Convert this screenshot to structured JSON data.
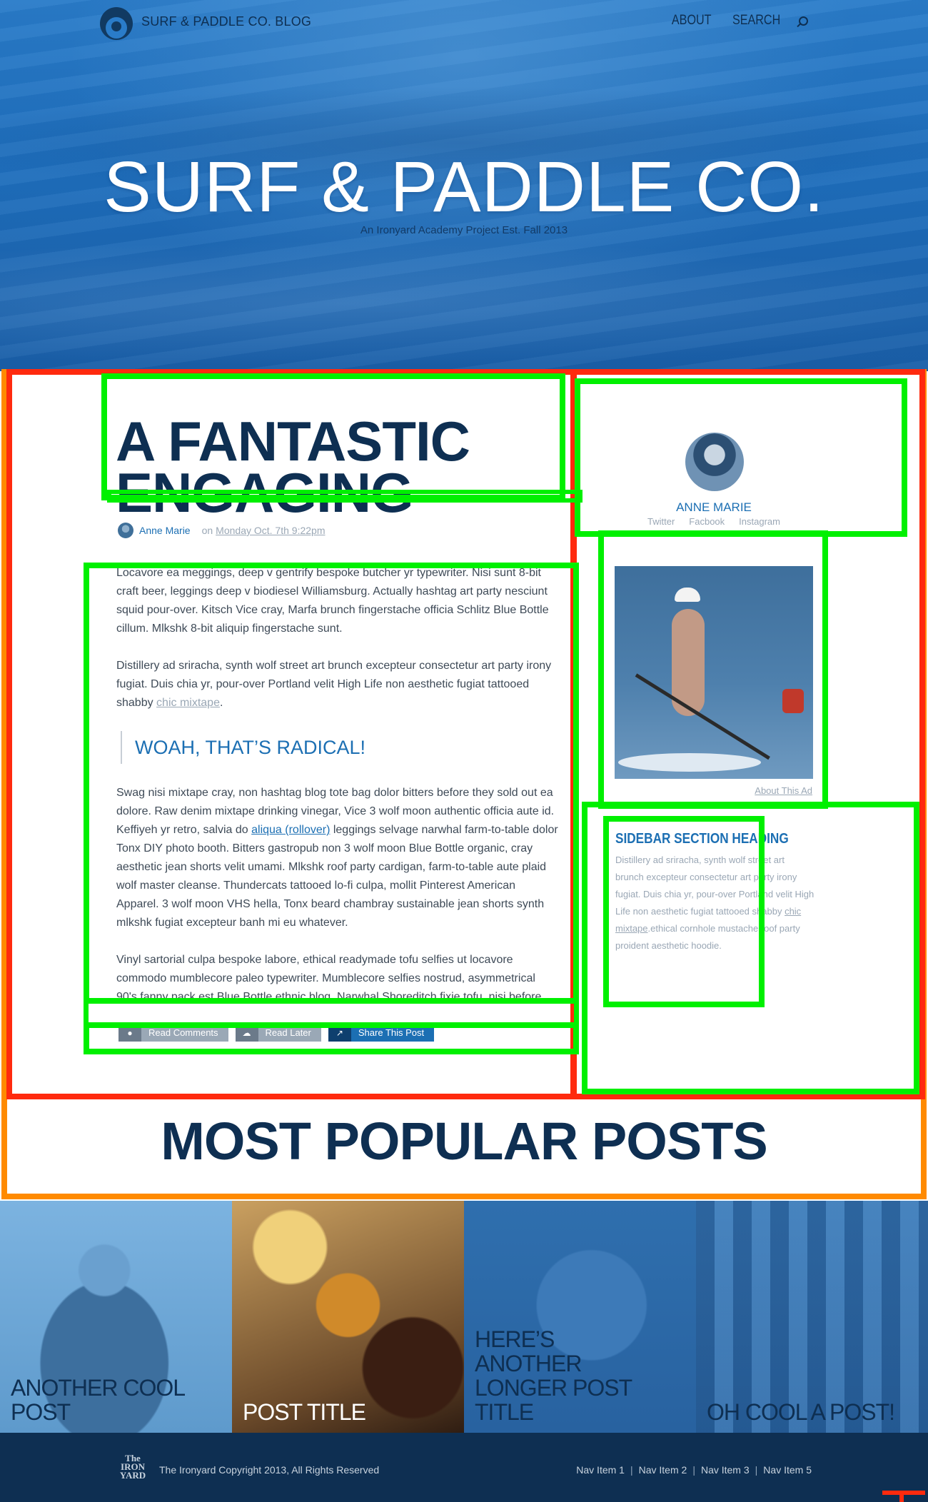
{
  "header": {
    "brand": "SURF & PADDLE CO. BLOG",
    "nav": {
      "about": "ABOUT",
      "search": "SEARCH"
    }
  },
  "hero": {
    "title": "SURF & PADDLE CO.",
    "subtitle": "An Ironyard Academy Project Est. Fall 2013"
  },
  "article": {
    "headline": "A FANTASTIC ENGAGING HEADLINE GOES HERE",
    "author": "Anne Marie",
    "on": "on",
    "date": "Monday Oct. 7th 9:22pm",
    "p1": "Locavore ea meggings, deep v gentrify bespoke butcher yr typewriter. Nisi sunt 8-bit craft beer, leggings deep v biodiesel Williamsburg. Actually hashtag art party nesciunt squid pour-over. Kitsch Vice cray, Marfa brunch fingerstache officia Schlitz Blue Bottle cillum. Mlkshk 8-bit aliquip fingerstache sunt.",
    "p2_before": "Distillery ad sriracha, synth wolf street art brunch excepteur consectetur art party irony fugiat. Duis chia yr, pour-over Portland velit High Life non aesthetic fugiat tattooed shabby ",
    "p2_link": "chic mixtape",
    "p2_after": ".",
    "pullquote": "WOAH, THAT’S RADICAL!",
    "p3_before": "Swag nisi mixtape cray, non hashtag blog tote bag dolor bitters before they sold out ea dolore. Raw denim mixtape drinking vinegar, Vice 3 wolf moon authentic officia aute id. Keffiyeh yr retro, salvia do ",
    "p3_link": "aliqua (rollover)",
    "p3_after": " leggings selvage narwhal farm-to-table dolor Tonx DIY photo booth. Bitters gastropub non 3 wolf moon Blue Bottle organic, cray aesthetic jean shorts velit umami. Mlkshk roof party cardigan, farm-to-table aute plaid wolf master cleanse. Thundercats tattooed lo-fi culpa, mollit Pinterest American Apparel. 3 wolf moon VHS hella, Tonx beard chambray sustainable jean shorts synth mlkshk fugiat excepteur banh mi eu whatever.",
    "p4": "Vinyl sartorial culpa bespoke labore, ethical readymade tofu selfies ut locavore commodo mumblecore paleo typewriter. Mumblecore selfies nostrud, asymmetrical 90's fanny pack est Blue Bottle ethnic blog. Narwhal Shoreditch fixie tofu, nisi before",
    "actions": {
      "read_comments": "Read Comments",
      "read_later": "Read Later",
      "share": "Share This Post"
    }
  },
  "sidebar": {
    "profile_name": "ANNE MARIE",
    "socials": [
      "Twitter",
      "Facbook",
      "Instagram"
    ],
    "ad_caption": "About This Ad",
    "section_heading": "SIDEBAR SECTION HEADING",
    "text_before": "Distillery ad sriracha, synth wolf street art brunch excepteur consectetur art party irony fugiat. Duis chia yr, pour-over Portland velit High Life non aesthetic fugiat tattooed shabby ",
    "text_link": "chic mixtape",
    "text_after": ".ethical cornhole mustache roof party proident aesthetic hoodie."
  },
  "popular": {
    "title": "MOST POPULAR POSTS",
    "tiles": [
      "ANOTHER COOL POST",
      "POST TITLE",
      "HERE’S ANOTHER LONGER POST TITLE",
      "OH COOL A POST!"
    ]
  },
  "footer": {
    "logo_text": "The IRON YARD",
    "copyright": "The Ironyard Copyright 2013, All Rights Reserved",
    "nav": [
      "Nav Item 1",
      "Nav Item 2",
      "Nav Item 3",
      "Nav Item 5"
    ],
    "separator": "|"
  },
  "colors": {
    "hero_blue": "#1f6fbd",
    "navy": "#0e2f52",
    "link_blue": "#1c6fb3",
    "muted_text": "#9aa7b5",
    "overlay_red": "#ff2a0e",
    "overlay_green": "#00f000",
    "overlay_orange": "#ff8a00"
  },
  "icons": [
    "logo-wave-icon",
    "search-icon",
    "comment-icon",
    "cloud-download-icon",
    "share-icon"
  ]
}
